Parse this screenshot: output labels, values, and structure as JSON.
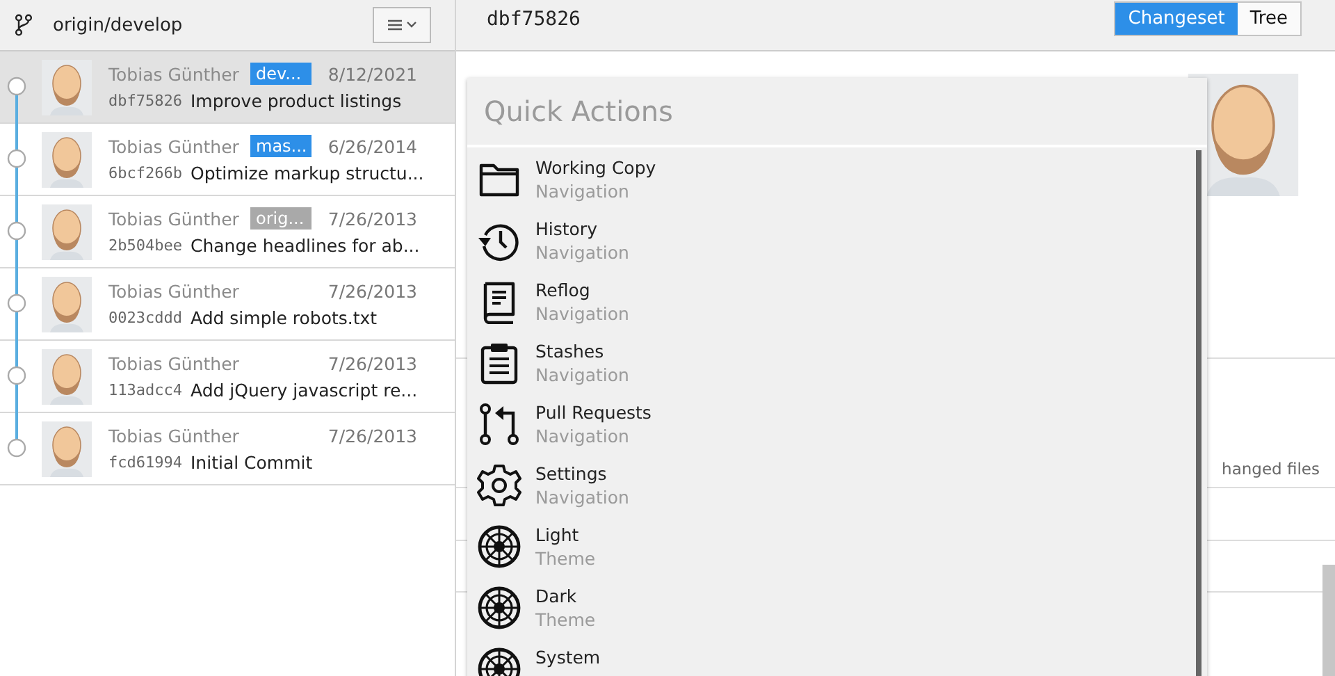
{
  "branch": {
    "name": "origin/develop"
  },
  "commits": [
    {
      "author": "Tobias Günther",
      "tag": {
        "label": "dev...",
        "color": "#2d8fe8"
      },
      "date": "8/12/2021",
      "hash": "dbf75826",
      "message": "Improve product listings",
      "selected": true
    },
    {
      "author": "Tobias Günther",
      "tag": {
        "label": "mas...",
        "color": "#2d8fe8"
      },
      "date": "6/26/2014",
      "hash": "6bcf266b",
      "message": "Optimize markup structu...",
      "selected": false
    },
    {
      "author": "Tobias Günther",
      "tag": {
        "label": "orig...",
        "color": "#a9a9a9"
      },
      "date": "7/26/2013",
      "hash": "2b504bee",
      "message": "Change headlines for ab...",
      "selected": false
    },
    {
      "author": "Tobias Günther",
      "date": "7/26/2013",
      "hash": "0023cddd",
      "message": "Add simple robots.txt",
      "selected": false
    },
    {
      "author": "Tobias Günther",
      "date": "7/26/2013",
      "hash": "113adcc4",
      "message": "Add jQuery javascript re...",
      "selected": false
    },
    {
      "author": "Tobias Günther",
      "date": "7/26/2013",
      "hash": "fcd61994",
      "message": "Initial Commit",
      "selected": false
    }
  ],
  "detail": {
    "hash": "dbf75826",
    "view_tabs": [
      {
        "label": "Changeset",
        "selected": true
      },
      {
        "label": "Tree",
        "selected": false
      }
    ],
    "changed_files_label": "hanged files"
  },
  "quick_actions": {
    "title": "Quick Actions",
    "items": [
      {
        "kind": "folder",
        "label": "Working Copy",
        "category": "Navigation"
      },
      {
        "kind": "history",
        "label": "History",
        "category": "Navigation"
      },
      {
        "kind": "book",
        "label": "Reflog",
        "category": "Navigation"
      },
      {
        "kind": "clipboard",
        "label": "Stashes",
        "category": "Navigation"
      },
      {
        "kind": "pull-request",
        "label": "Pull Requests",
        "category": "Navigation"
      },
      {
        "kind": "gear",
        "label": "Settings",
        "category": "Navigation"
      },
      {
        "kind": "theme",
        "label": "Light",
        "category": "Theme"
      },
      {
        "kind": "theme",
        "label": "Dark",
        "category": "Theme"
      },
      {
        "kind": "theme",
        "label": "System"
      }
    ]
  }
}
